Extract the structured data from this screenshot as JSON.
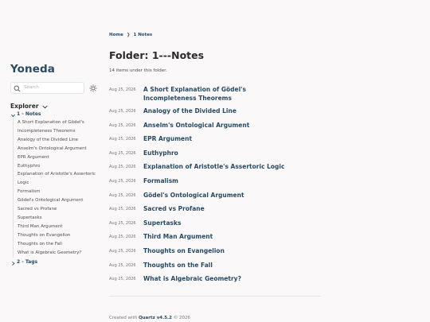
{
  "site": {
    "title": "Yoneda"
  },
  "search": {
    "placeholder": "Search"
  },
  "explorer": {
    "title": "Explorer",
    "folders": [
      {
        "label": "1 - Notes",
        "expanded": true,
        "items": [
          "A Short Explanation of Gödel's Incompleteness Theorems",
          "Analogy of the Divided Line",
          "Anselm's Ontological Argument",
          "EPR Argument",
          "Euthyphro",
          "Explanation of Aristotle's Assertoric Logic",
          "Formalism",
          "Gödel's Ontological Argument",
          "Sacred vs Profane",
          "Supertasks",
          "Third Man Argument",
          "Thoughts on Evangelion",
          "Thoughts on the Fall",
          "What is Algebraic Geometry?"
        ]
      },
      {
        "label": "2 - Tags",
        "expanded": false,
        "items": []
      }
    ]
  },
  "breadcrumb": {
    "home": "Home",
    "separator": "❯",
    "current": "1 Notes"
  },
  "page": {
    "title": "Folder: 1---Notes",
    "count_text": "14 items under this folder."
  },
  "notes": [
    {
      "date": "Aug 25, 2026",
      "title": "A Short Explanation of Gödel's Incompleteness Theorems"
    },
    {
      "date": "Aug 25, 2026",
      "title": "Analogy of the Divided Line"
    },
    {
      "date": "Aug 25, 2026",
      "title": "Anselm's Ontological Argument"
    },
    {
      "date": "Aug 25, 2026",
      "title": "EPR Argument"
    },
    {
      "date": "Aug 25, 2026",
      "title": "Euthyphro"
    },
    {
      "date": "Aug 25, 2026",
      "title": "Explanation of Aristotle's Assertoric Logic"
    },
    {
      "date": "Aug 25, 2026",
      "title": "Formalism"
    },
    {
      "date": "Aug 25, 2026",
      "title": "Gödel's Ontological Argument"
    },
    {
      "date": "Aug 25, 2026",
      "title": "Sacred vs Profane"
    },
    {
      "date": "Aug 25, 2026",
      "title": "Supertasks"
    },
    {
      "date": "Aug 25, 2026",
      "title": "Third Man Argument"
    },
    {
      "date": "Aug 25, 2026",
      "title": "Thoughts on Evangelion"
    },
    {
      "date": "Aug 25, 2026",
      "title": "Thoughts on the Fall"
    },
    {
      "date": "Aug 25, 2026",
      "title": "What is Algebraic Geometry?"
    }
  ],
  "footer": {
    "prefix": "Created with",
    "link": "Quartz v4.5.2",
    "suffix": "© 2026"
  },
  "colors": {
    "accent": "#284b63",
    "text": "#2b2b2b",
    "muted": "#777777",
    "background": "#faf8f8"
  },
  "icons": {
    "search": "search-icon",
    "theme": "sun-icon",
    "chevron_down": "chevron-down-icon",
    "chevron_right": "chevron-right-icon"
  }
}
